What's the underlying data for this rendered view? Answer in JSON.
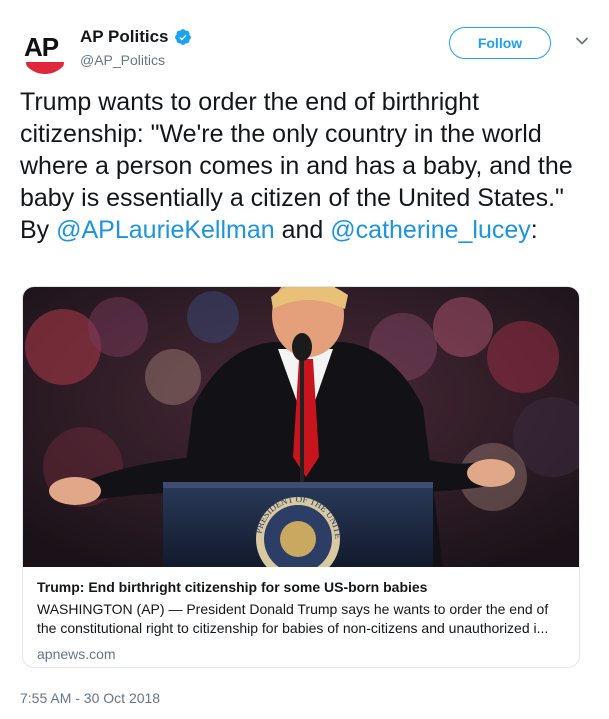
{
  "account": {
    "display_name": "AP Politics",
    "handle": "@AP_Politics",
    "avatar_text": "AP",
    "verified_icon": "verified-badge-icon"
  },
  "actions": {
    "follow_label": "Follow",
    "menu_icon": "chevron-down-icon"
  },
  "tweet": {
    "text": "Trump wants to order the end of birthright citizenship: \"We're the only country in the world where a person comes in and has a baby, and the baby is essentially a citizen of the United States.\" By ",
    "mention1": "@APLaurieKellman",
    "conjunction": " and ",
    "mention2": "@catherine_lucey",
    "suffix": ":"
  },
  "card": {
    "seal_text": "PRESIDENT OF THE UNITED",
    "title": "Trump: End birthright citizenship for some US-born babies",
    "description": "WASHINGTON (AP) — President Donald Trump says he wants to order the end of the constitutional right to citizenship for babies of non-citizens and unauthorized i...",
    "domain": "apnews.com"
  },
  "meta": {
    "timestamp": "7:55 AM - 30 Oct 2018"
  },
  "colors": {
    "link": "#1b95e0",
    "follow_border": "#1da1f2",
    "secondary_text": "#657786",
    "ap_red": "#e0283d"
  }
}
